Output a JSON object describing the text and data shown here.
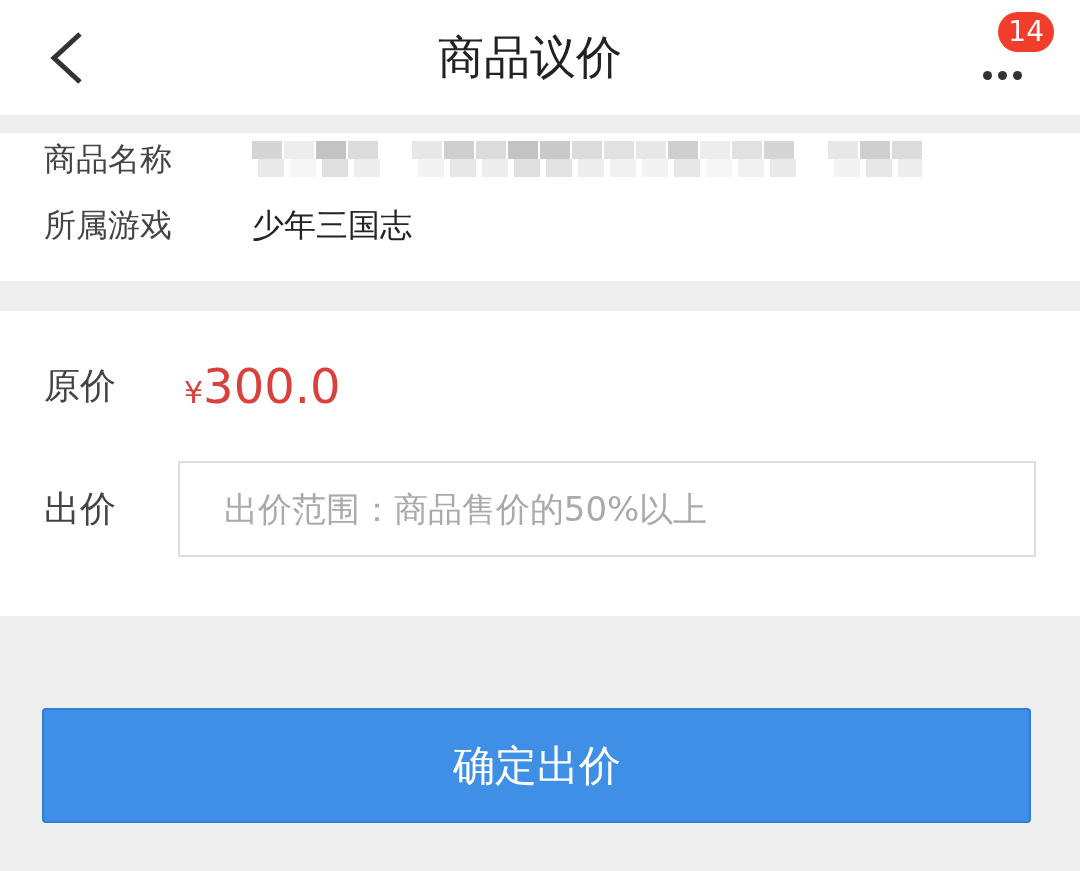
{
  "header": {
    "title": "商品议价",
    "badge": "14"
  },
  "info": [
    {
      "label": "商品名称",
      "kind": "redacted"
    },
    {
      "label": "所属游戏",
      "kind": "text",
      "value": "少年三国志"
    }
  ],
  "price": {
    "label": "原价",
    "currency": "¥",
    "amount": "300.0"
  },
  "offer": {
    "label": "出价",
    "placeholder": "出价范围：商品售价的50%以上"
  },
  "submit": "确定出价"
}
